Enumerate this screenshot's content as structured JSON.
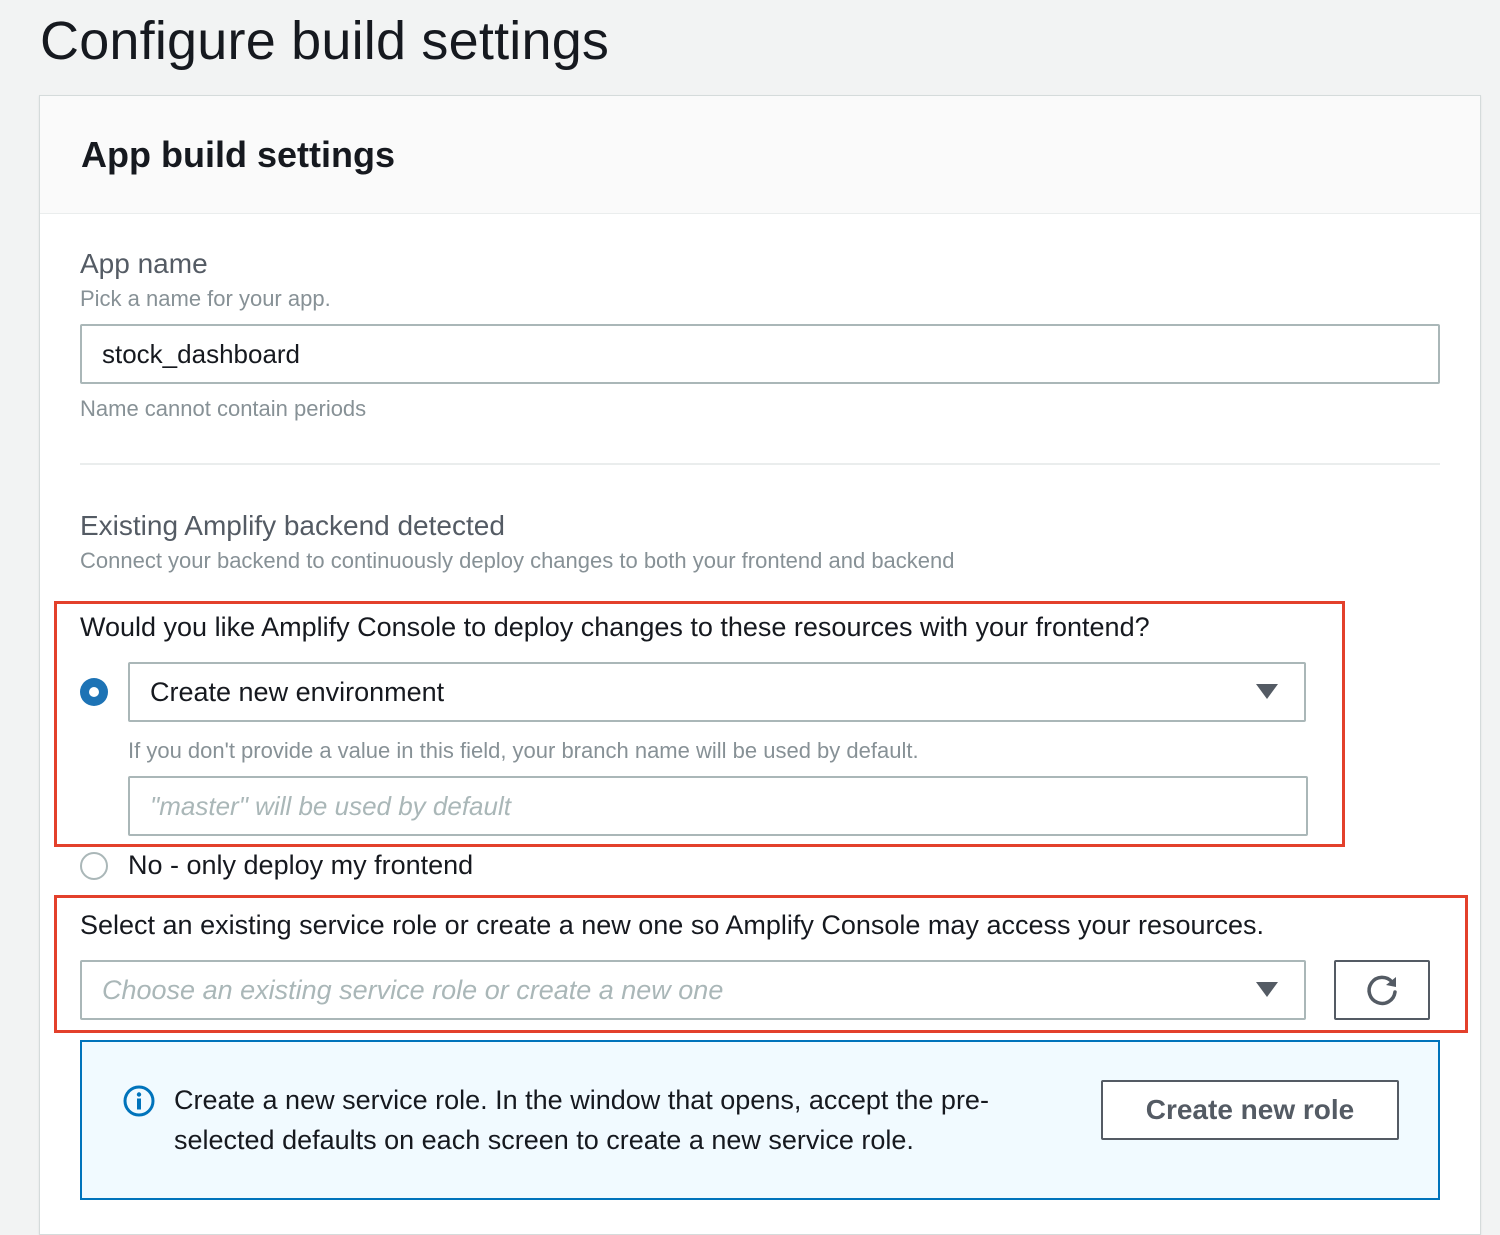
{
  "page": {
    "title": "Configure build settings"
  },
  "panel": {
    "title": "App build settings"
  },
  "app_name": {
    "label": "App name",
    "description": "Pick a name for your app.",
    "value": "stock_dashboard",
    "constraint": "Name cannot contain periods"
  },
  "backend": {
    "heading": "Existing Amplify backend detected",
    "description": "Connect your backend to continuously deploy changes to both your frontend and backend",
    "question": "Would you like Amplify Console to deploy changes to these resources with your frontend?",
    "option_create": {
      "selected_value": "Create new environment",
      "checked": true
    },
    "env_hint": "If you don't provide a value in this field, your branch name will be used by default.",
    "env_placeholder": "\"master\" will be used by default",
    "option_no": {
      "label": "No - only deploy my frontend",
      "checked": false
    }
  },
  "service_role": {
    "prompt": "Select an existing service role or create a new one so Amplify Console may access your resources.",
    "placeholder": "Choose an existing service role or create a new one"
  },
  "info": {
    "text": "Create a new service role. In the window that opens, accept the pre-selected defaults on each screen to create a new service role.",
    "line1": "Create a new service role. In the window that opens, accept the pre-",
    "line2": "selected defaults on each screen to create a new service role.",
    "button_label": "Create new role"
  },
  "colors": {
    "highlight": "#e3402b",
    "accent": "#1d73b5",
    "info_border": "#0073bb",
    "info_background": "#f1faff"
  },
  "icons": {
    "info": "info-icon",
    "refresh": "refresh-icon",
    "caret": "caret-down-icon"
  }
}
